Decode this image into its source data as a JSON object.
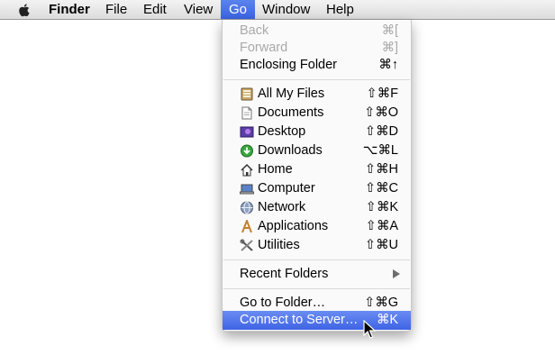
{
  "menubar": {
    "items": [
      {
        "label": "Finder"
      },
      {
        "label": "File"
      },
      {
        "label": "Edit"
      },
      {
        "label": "View"
      },
      {
        "label": "Go"
      },
      {
        "label": "Window"
      },
      {
        "label": "Help"
      }
    ],
    "active": "Go",
    "apple_icon": "apple-logo-icon"
  },
  "go_menu": {
    "history": [
      {
        "label": "Back",
        "shortcut": "⌘[",
        "enabled": false
      },
      {
        "label": "Forward",
        "shortcut": "⌘]",
        "enabled": false
      },
      {
        "label": "Enclosing Folder",
        "shortcut": "⌘↑",
        "enabled": true
      }
    ],
    "places": [
      {
        "label": "All My Files",
        "shortcut": "⇧⌘F",
        "icon": "all-my-files-icon"
      },
      {
        "label": "Documents",
        "shortcut": "⇧⌘O",
        "icon": "documents-icon"
      },
      {
        "label": "Desktop",
        "shortcut": "⇧⌘D",
        "icon": "desktop-icon"
      },
      {
        "label": "Downloads",
        "shortcut": "⌥⌘L",
        "icon": "downloads-icon"
      },
      {
        "label": "Home",
        "shortcut": "⇧⌘H",
        "icon": "home-icon"
      },
      {
        "label": "Computer",
        "shortcut": "⇧⌘C",
        "icon": "computer-icon"
      },
      {
        "label": "Network",
        "shortcut": "⇧⌘K",
        "icon": "network-icon"
      },
      {
        "label": "Applications",
        "shortcut": "⇧⌘A",
        "icon": "applications-icon"
      },
      {
        "label": "Utilities",
        "shortcut": "⇧⌘U",
        "icon": "utilities-icon"
      }
    ],
    "recent": {
      "label": "Recent Folders"
    },
    "server": [
      {
        "label": "Go to Folder…",
        "shortcut": "⇧⌘G"
      },
      {
        "label": "Connect to Server…",
        "shortcut": "⌘K",
        "highlighted": true
      }
    ]
  },
  "colors": {
    "highlight": "#3f64e4",
    "disabled_text": "#a9a9a9",
    "menubar_bg": "#e8e8e8"
  }
}
